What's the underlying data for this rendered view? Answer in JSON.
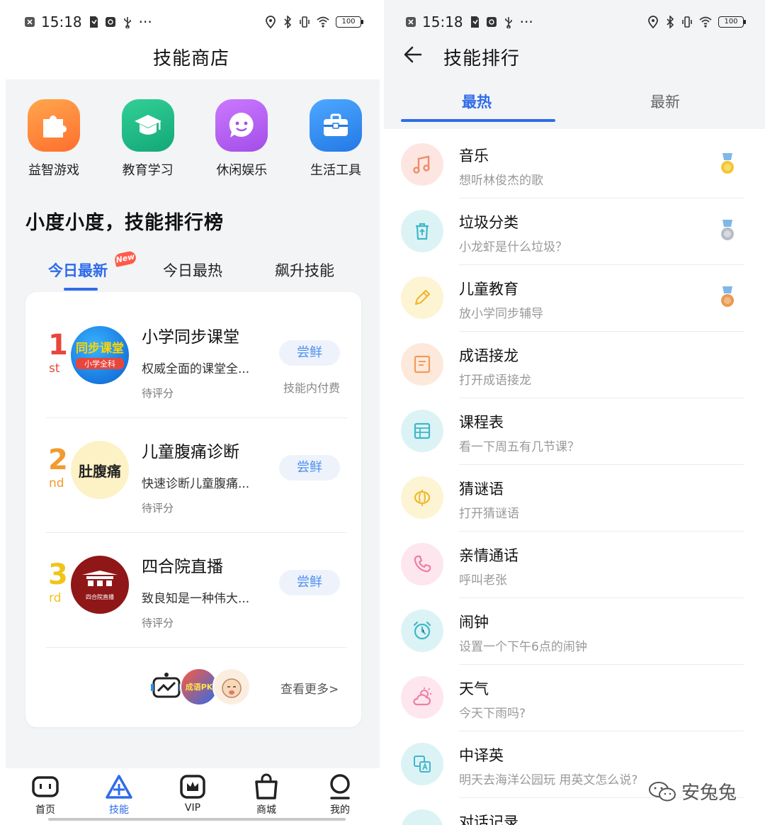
{
  "left": {
    "status": {
      "time": "15:18",
      "battery": "100"
    },
    "header_title": "技能商店",
    "categories": [
      {
        "label": "益智游戏",
        "icon": "puzzle-icon",
        "color": "#ff8a3d"
      },
      {
        "label": "教育学习",
        "icon": "graduation-cap-icon",
        "color": "#1fb985"
      },
      {
        "label": "休闲娱乐",
        "icon": "smile-face-icon",
        "color": "#b45ef2"
      },
      {
        "label": "生活工具",
        "icon": "toolbox-icon",
        "color": "#2f8ef0"
      }
    ],
    "ranking_title": "小度小度，技能排行榜",
    "ranking_tabs": [
      {
        "label": "今日最新",
        "active": true,
        "badge": "New"
      },
      {
        "label": "今日最热",
        "active": false
      },
      {
        "label": "飙升技能",
        "active": false
      }
    ],
    "ranking_items": [
      {
        "rank": "1",
        "suffix": "st",
        "rank_color": "#e8453c",
        "title": "小学同步课堂",
        "desc": "权威全面的课堂全...",
        "score": "待评分",
        "button": "尝鲜",
        "sub": "技能内付费",
        "thumb_text": "同步课堂",
        "thumb_sub": "小学全科"
      },
      {
        "rank": "2",
        "suffix": "nd",
        "rank_color": "#f29a2e",
        "title": "儿童腹痛诊断",
        "desc": "快速诊断儿童腹痛...",
        "score": "待评分",
        "button": "尝鲜",
        "sub": "",
        "thumb_text": "肚腹痛"
      },
      {
        "rank": "3",
        "suffix": "rd",
        "rank_color": "#f0c419",
        "title": "四合院直播",
        "desc": "致良知是一种伟大...",
        "score": "待评分",
        "button": "尝鲜",
        "sub": "",
        "thumb_text": "四合院直播"
      }
    ],
    "more_link": "查看更多>",
    "more_thumb_text": "成语PK",
    "bottom_nav": [
      {
        "label": "首页",
        "icon": "home-robot-icon",
        "active": false
      },
      {
        "label": "技能",
        "icon": "triangle-skill-icon",
        "active": true
      },
      {
        "label": "VIP",
        "icon": "crown-icon",
        "active": false
      },
      {
        "label": "商城",
        "icon": "shopping-bag-icon",
        "active": false
      },
      {
        "label": "我的",
        "icon": "profile-icon",
        "active": false
      }
    ]
  },
  "right": {
    "status": {
      "time": "15:18",
      "battery": "100"
    },
    "title": "技能排行",
    "tabs": [
      {
        "label": "最热",
        "active": true
      },
      {
        "label": "最新",
        "active": false
      }
    ],
    "list": [
      {
        "name": "音乐",
        "desc": "想听林俊杰的歌",
        "icon": "music-note-icon",
        "bg": "#fde6e1",
        "fg": "#f08b6d",
        "medal": "gold"
      },
      {
        "name": "垃圾分类",
        "desc": "小龙虾是什么垃圾？",
        "icon": "recycle-bin-icon",
        "bg": "#dcf3f6",
        "fg": "#3fb7c9",
        "medal": "silver"
      },
      {
        "name": "儿童教育",
        "desc": "放小学同步辅导",
        "icon": "pencil-icon",
        "bg": "#fdf4d4",
        "fg": "#f0b72e",
        "medal": "bronze"
      },
      {
        "name": "成语接龙",
        "desc": "打开成语接龙",
        "icon": "idiom-book-icon",
        "bg": "#fde9db",
        "fg": "#f29a5c",
        "medal": ""
      },
      {
        "name": "课程表",
        "desc": "看一下周五有几节课？",
        "icon": "timetable-icon",
        "bg": "#dcf3f6",
        "fg": "#3fb7c9",
        "medal": ""
      },
      {
        "name": "猜谜语",
        "desc": "打开猜谜语",
        "icon": "lantern-icon",
        "bg": "#fdf4d4",
        "fg": "#f0b72e",
        "medal": ""
      },
      {
        "name": "亲情通话",
        "desc": "呼叫老张",
        "icon": "phone-icon",
        "bg": "#fde6ee",
        "fg": "#ee7ea2",
        "medal": ""
      },
      {
        "name": "闹钟",
        "desc": "设置一个下午6点的闹钟",
        "icon": "alarm-clock-icon",
        "bg": "#dcf3f6",
        "fg": "#3fb7c9",
        "medal": ""
      },
      {
        "name": "天气",
        "desc": "今天下雨吗?",
        "icon": "weather-icon",
        "bg": "#fde6ee",
        "fg": "#ee7ea2",
        "medal": ""
      },
      {
        "name": "中译英",
        "desc": "明天去海洋公园玩 用英文怎么说?",
        "icon": "translate-icon",
        "bg": "#dcf3f6",
        "fg": "#3fb7c9",
        "medal": ""
      },
      {
        "name": "对话记录",
        "desc": "",
        "icon": "chat-log-icon",
        "bg": "#dcf3f6",
        "fg": "#3fb7c9",
        "medal": ""
      }
    ],
    "watermark": "安兔兔"
  }
}
